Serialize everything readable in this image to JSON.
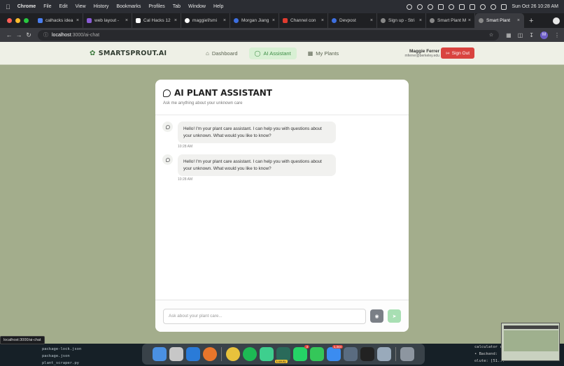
{
  "menubar": {
    "app": "Chrome",
    "items": [
      "File",
      "Edit",
      "View",
      "History",
      "Bookmarks",
      "Profiles",
      "Tab",
      "Window",
      "Help"
    ],
    "datetime": "Sun Oct 26  10:28 AM"
  },
  "tabs": [
    {
      "title": "calhacks idea",
      "color": "#4a7ef0"
    },
    {
      "title": "web layout -",
      "color": "#8a5cd6"
    },
    {
      "title": "Cal Hacks 12",
      "color": "#ffffff"
    },
    {
      "title": "maggief/smi",
      "color": "#ffffff"
    },
    {
      "title": "Morgan Jiang",
      "color": "#3d6fe0"
    },
    {
      "title": "Channel con",
      "color": "#e03b2f"
    },
    {
      "title": "Devpost",
      "color": "#3d6fe0"
    },
    {
      "title": "Sign up - Stri",
      "color": "#888888"
    },
    {
      "title": "Smart Plant M",
      "color": "#888888"
    },
    {
      "title": "Smart Plant",
      "color": "#888888",
      "active": true
    }
  ],
  "address": {
    "host": "localhost",
    "path": ":3000/ai-chat"
  },
  "profile_initial": "M",
  "app": {
    "logo": "SMARTSPROUT.AI",
    "nav": {
      "dashboard": "Dashboard",
      "ai_assistant": "AI Assistant",
      "my_plants": "My Plants"
    },
    "user": {
      "name": "Maggie Ferrer",
      "email": "mferrer@berkeley.edu"
    },
    "sign_out": "Sign Out"
  },
  "chat": {
    "title": "AI PLANT ASSISTANT",
    "subtitle": "Ask me anything about your unknown care",
    "messages": [
      {
        "text": "Hello! I'm your plant care assistant. I can help you with questions about your unknown. What would you like to know?",
        "time": "10:28 AM"
      },
      {
        "text": "Hello! I'm your plant care assistant. I can help you with questions about your unknown. What would you like to know?",
        "time": "10:28 AM"
      }
    ],
    "input_placeholder": "Ask about your plant care..."
  },
  "status_url": "localhost:3000/ai-chat",
  "files": [
    "package-lock.json",
    "package.json",
    "plant_scraper.py"
  ],
  "dock_badges": {
    "whatsapp": "3",
    "mail": "1,344",
    "luxury": "Luxury"
  },
  "terminal": [
    "calculator ran",
    "• Backend:",
    "  olute: [51..."
  ]
}
